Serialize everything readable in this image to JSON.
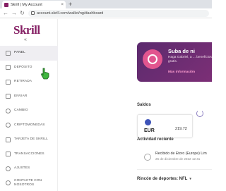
{
  "browser": {
    "tab_title": "Skrill | My Account",
    "tab_close": "×",
    "new_tab": "+",
    "url": "account.skrill.com/wallet/ng/dashboard"
  },
  "sidebar": {
    "logo": "Skrill",
    "collapse_glyph": "«",
    "items": [
      {
        "label": "PANEL",
        "icon": "dashboard-icon",
        "active": true
      },
      {
        "label": "DEPÓSITO",
        "icon": "deposit-icon"
      },
      {
        "label": "RETIRADA",
        "icon": "withdraw-icon"
      },
      {
        "label": "ENVIAR",
        "icon": "send-icon"
      },
      {
        "label": "CAMBIO",
        "icon": "exchange-icon"
      },
      {
        "label": "CRIPTOMONEDAS",
        "icon": "crypto-icon"
      },
      {
        "label": "TARJETA DE SKRILL",
        "icon": "card-icon"
      },
      {
        "label": "TRANSACCIONES",
        "icon": "transactions-icon"
      },
      {
        "label": "AJUSTES",
        "icon": "gear-icon"
      },
      {
        "label": "CONTACTE CON NOSOTROS",
        "icon": "contact-icon"
      }
    ]
  },
  "promo": {
    "title": "Suba de ni",
    "text": "Haga Gabriel, a ... beneficios gratis.",
    "link": "Más información"
  },
  "balances": {
    "title": "Saldos",
    "currency": "EUR",
    "amount": "219.72"
  },
  "activity": {
    "title": "Actividad reciente",
    "description": "Recibido de Etoro (Europe) Lim",
    "date": "26 de diciembre de 2022 12:41"
  },
  "sports": {
    "label": "Rincón de deportes: NFL",
    "dropdown_glyph": "▾"
  },
  "colors": {
    "brand": "#862165",
    "promo_bg": "#6a2b72",
    "active_item_bg": "#efeef2"
  }
}
